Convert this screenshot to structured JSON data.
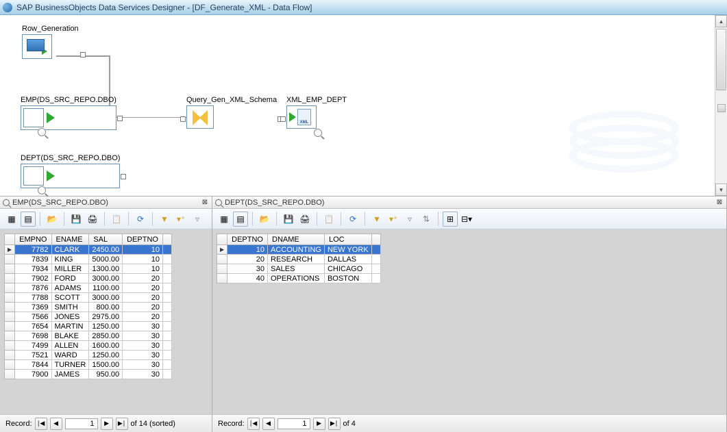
{
  "title": "SAP BusinessObjects Data Services Designer - [DF_Generate_XML - Data Flow]",
  "canvas": {
    "row_gen": {
      "label": "Row_Generation"
    },
    "emp_src": {
      "label": "EMP(DS_SRC_REPO.DBO)"
    },
    "dept_src": {
      "label": "DEPT(DS_SRC_REPO.DBO)"
    },
    "query": {
      "label": "Query_Gen_XML_Schema"
    },
    "xml_out": {
      "label": "XML_EMP_DEPT",
      "doc_text": "XML"
    }
  },
  "panels": {
    "emp": {
      "title": "EMP(DS_SRC_REPO.DBO)",
      "columns": [
        "EMPNO",
        "ENAME",
        "SAL",
        "DEPTNO"
      ],
      "rows": [
        {
          "EMPNO": "7782",
          "ENAME": "CLARK",
          "SAL": "2450.00",
          "DEPTNO": "10",
          "sel": true
        },
        {
          "EMPNO": "7839",
          "ENAME": "KING",
          "SAL": "5000.00",
          "DEPTNO": "10"
        },
        {
          "EMPNO": "7934",
          "ENAME": "MILLER",
          "SAL": "1300.00",
          "DEPTNO": "10"
        },
        {
          "EMPNO": "7902",
          "ENAME": "FORD",
          "SAL": "3000.00",
          "DEPTNO": "20"
        },
        {
          "EMPNO": "7876",
          "ENAME": "ADAMS",
          "SAL": "1100.00",
          "DEPTNO": "20"
        },
        {
          "EMPNO": "7788",
          "ENAME": "SCOTT",
          "SAL": "3000.00",
          "DEPTNO": "20"
        },
        {
          "EMPNO": "7369",
          "ENAME": "SMITH",
          "SAL": "800.00",
          "DEPTNO": "20"
        },
        {
          "EMPNO": "7566",
          "ENAME": "JONES",
          "SAL": "2975.00",
          "DEPTNO": "20"
        },
        {
          "EMPNO": "7654",
          "ENAME": "MARTIN",
          "SAL": "1250.00",
          "DEPTNO": "30"
        },
        {
          "EMPNO": "7698",
          "ENAME": "BLAKE",
          "SAL": "2850.00",
          "DEPTNO": "30"
        },
        {
          "EMPNO": "7499",
          "ENAME": "ALLEN",
          "SAL": "1600.00",
          "DEPTNO": "30"
        },
        {
          "EMPNO": "7521",
          "ENAME": "WARD",
          "SAL": "1250.00",
          "DEPTNO": "30"
        },
        {
          "EMPNO": "7844",
          "ENAME": "TURNER",
          "SAL": "1500.00",
          "DEPTNO": "30"
        },
        {
          "EMPNO": "7900",
          "ENAME": "JAMES",
          "SAL": "950.00",
          "DEPTNO": "30"
        }
      ],
      "nav": {
        "label": "Record:",
        "current": "1",
        "total": "of 14 (sorted)"
      }
    },
    "dept": {
      "title": "DEPT(DS_SRC_REPO.DBO)",
      "columns": [
        "DEPTNO",
        "DNAME",
        "LOC"
      ],
      "rows": [
        {
          "DEPTNO": "10",
          "DNAME": "ACCOUNTING",
          "LOC": "NEW YORK",
          "sel": true
        },
        {
          "DEPTNO": "20",
          "DNAME": "RESEARCH",
          "LOC": "DALLAS"
        },
        {
          "DEPTNO": "30",
          "DNAME": "SALES",
          "LOC": "CHICAGO"
        },
        {
          "DEPTNO": "40",
          "DNAME": "OPERATIONS",
          "LOC": "BOSTON"
        }
      ],
      "nav": {
        "label": "Record:",
        "current": "1",
        "total": "of 4"
      }
    }
  }
}
